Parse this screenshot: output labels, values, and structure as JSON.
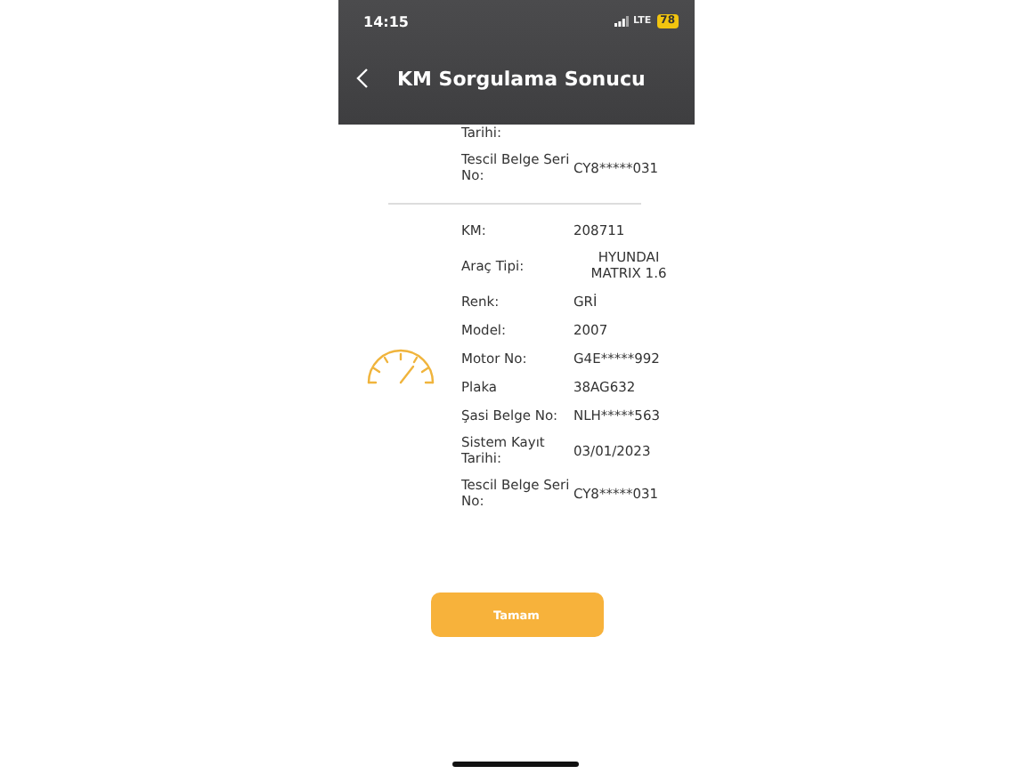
{
  "status_bar": {
    "time": "14:15",
    "network": "LTE",
    "battery": "78"
  },
  "header": {
    "title": "KM Sorgulama Sonucu"
  },
  "previous_record": [
    {
      "label": "Tarihi:"
    },
    {
      "label": "Tescil Belge Seri No:",
      "value": "CY8*****031"
    }
  ],
  "details": [
    {
      "label": "KM:",
      "value": "208711"
    },
    {
      "label": "Araç Tipi:",
      "value": "HYUNDAI MATRIX 1.6"
    },
    {
      "label": "Renk:",
      "value": "GRİ"
    },
    {
      "label": "Model:",
      "value": "2007"
    },
    {
      "label": "Motor No:",
      "value": "G4E*****992"
    },
    {
      "label": "Plaka",
      "value": "38AG632"
    },
    {
      "label": "Şasi Belge No:",
      "value": "NLH*****563"
    },
    {
      "label": "Sistem Kayıt Tarihi:",
      "value": "03/01/2023"
    },
    {
      "label": "Tescil Belge Seri No:",
      "value": "CY8*****031"
    }
  ],
  "button": {
    "label": "Tamam"
  }
}
